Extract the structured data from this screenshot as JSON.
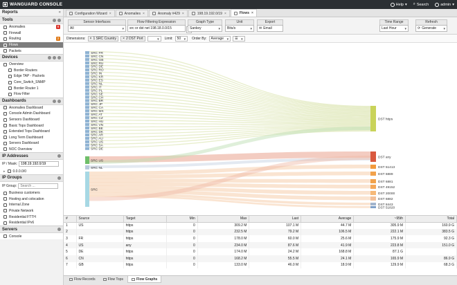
{
  "app": {
    "title": "Wanguard Console",
    "help": "Help",
    "search": "Search",
    "user": "admin"
  },
  "sidebar": {
    "title": "Reports",
    "tools": {
      "title": "Tools",
      "items": [
        {
          "label": "Anomalies",
          "badge": "8",
          "badge_color": "#d9342b"
        },
        {
          "label": "Firewall",
          "badge": ""
        },
        {
          "label": "Routing",
          "badge": "2",
          "badge_color": "#e07b19"
        },
        {
          "label": "Flows",
          "badge": "",
          "selected": true
        },
        {
          "label": "Packets",
          "badge": ""
        }
      ]
    },
    "devices": {
      "title": "Devices",
      "items": [
        "Overview",
        "Border Routers",
        "Edge TAP - Packets",
        "Core_Switch_SNMP",
        "Border Router 1",
        "Flow Filter"
      ]
    },
    "dashboards": {
      "title": "Dashboards",
      "items": [
        "Anomalies Dashboard",
        "Console Admin Dashboard",
        "Sensors Dashboard",
        "Basic Tops Dashboard",
        "Extended Tops Dashboard",
        "Long Term Dashboard",
        "Servers Dashboard",
        "NOC Overview"
      ]
    },
    "ip_addresses": {
      "title": "IP Addresses",
      "label": "IP / Mask:",
      "value": "198.19.192.0/19",
      "tree": "0.0.0.0/0"
    },
    "ip_groups": {
      "title": "IP Groups",
      "label": "IP Group:",
      "placeholder": "Search ...",
      "items": [
        "Business customers",
        "Hosting and colocation",
        "Internal Zone",
        "Private Network",
        "Residential FTTH",
        "Residential IPv6"
      ]
    },
    "servers": {
      "title": "Servers",
      "items": [
        "Console"
      ]
    }
  },
  "tabs": [
    {
      "label": "Configuration Wizard"
    },
    {
      "label": "Anomalies"
    },
    {
      "label": "Anomaly #429"
    },
    {
      "label": "198.19.192.0/19"
    },
    {
      "label": "Flows",
      "active": true
    }
  ],
  "toolbar": {
    "sensor": {
      "label": "Sensor Interfaces",
      "value": "All"
    },
    "filter": {
      "label": "Flow Filtering Expression",
      "value": "src or dst net 198.18.0.0/15"
    },
    "graph": {
      "label": "Graph Type",
      "value": "Sankey"
    },
    "unit": {
      "label": "Unit",
      "value": "Bits/s"
    },
    "export": {
      "label": "Export",
      "value": "Email"
    },
    "time": {
      "label": "Time Range",
      "value": "Last Hour"
    },
    "refresh": {
      "label": "Refresh",
      "value": "Generate"
    }
  },
  "dims": {
    "label": "Dimensions:",
    "chip1": "1  SRC Country",
    "chip2": "2  DST Port",
    "limit_label": "Limit:",
    "limit": "50",
    "order_label": "Order By:",
    "order": "Average"
  },
  "sankey": {
    "sources": [
      "SRC FR",
      "SRC CN",
      "SRC GB",
      "SRC RU",
      "SRC DE",
      "SRC RO",
      "SRC IN",
      "SRC KR",
      "SRC ES",
      "SRC NL",
      "SRC IT",
      "SRC PL",
      "SRC SE",
      "SRC CH",
      "SRC BR",
      "SRC JP",
      "SRC CA",
      "SRC MX",
      "SRC AT",
      "SRC CZ",
      "SRC HU",
      "SRC VN",
      "SRC BE",
      "SRC DK",
      "SRC AR",
      "SRC AU",
      "SRC US",
      "SRC SA",
      "SRC DE"
    ],
    "big_sources": [
      {
        "label": "SRC US",
        "color": "#6fbf6a"
      },
      {
        "label": "SRC NL",
        "color": "#b9c9dc"
      },
      {
        "label": "SRC",
        "color": "#a7d8e4"
      }
    ],
    "targets": [
      {
        "label": "DST https",
        "color": "#c9d35a"
      },
      {
        "label": "DST any",
        "color": "#d9593f"
      },
      {
        "label": "DST 51413",
        "color": "#f29a3c"
      },
      {
        "label": "DST 6889",
        "color": "#f2a24b"
      },
      {
        "label": "DST 6881",
        "color": "#f2a24b"
      },
      {
        "label": "DST 49152",
        "color": "#f4a85a"
      },
      {
        "label": "DST 20000",
        "color": "#f6b978"
      },
      {
        "label": "DST 6882",
        "color": "#f2c09a"
      },
      {
        "label": "DST 8443",
        "color": "#a2b4cc"
      },
      {
        "label": "DST 51820",
        "color": "#7fa0c8"
      }
    ]
  },
  "grid": {
    "headers": [
      "#",
      "Source",
      "Target",
      "Min",
      "Max",
      "Last",
      "Average",
      "~95th",
      "Total"
    ],
    "rows": [
      [
        "1",
        "US",
        "https",
        "0",
        "309.2 M",
        "107.1 M",
        "44.7 M",
        "305.9 M",
        "160.9 G"
      ],
      [
        "2",
        "",
        "https",
        "0",
        "232.5 M",
        "79.2 M",
        "106.5 M",
        "222.1 M",
        "383.5 G"
      ],
      [
        "3",
        "FR",
        "https",
        "0",
        "178.0 M",
        "60.0 M",
        "25.6 M",
        "175.9 M",
        "92.3 G"
      ],
      [
        "4",
        "US",
        "any",
        "0",
        "234.0 M",
        "87.6 M",
        "41.9 M",
        "223.8 M",
        "151.0 G"
      ],
      [
        "5",
        "DE",
        "https",
        "0",
        "174.0 M",
        "24.2 M",
        "168.8 M",
        "87.1 G",
        ""
      ],
      [
        "6",
        "CN",
        "https",
        "0",
        "168.2 M",
        "55.5 M",
        "24.1 M",
        "165.9 M",
        "86.9 G"
      ],
      [
        "7",
        "GB",
        "https",
        "0",
        "133.0 M",
        "46.0 M",
        "18.9 M",
        "129.9 M",
        "68.3 G"
      ]
    ]
  },
  "bottom_tabs": [
    {
      "label": "Flow Records"
    },
    {
      "label": "Flow Tops"
    },
    {
      "label": "Flow Graphs",
      "active": true
    }
  ]
}
